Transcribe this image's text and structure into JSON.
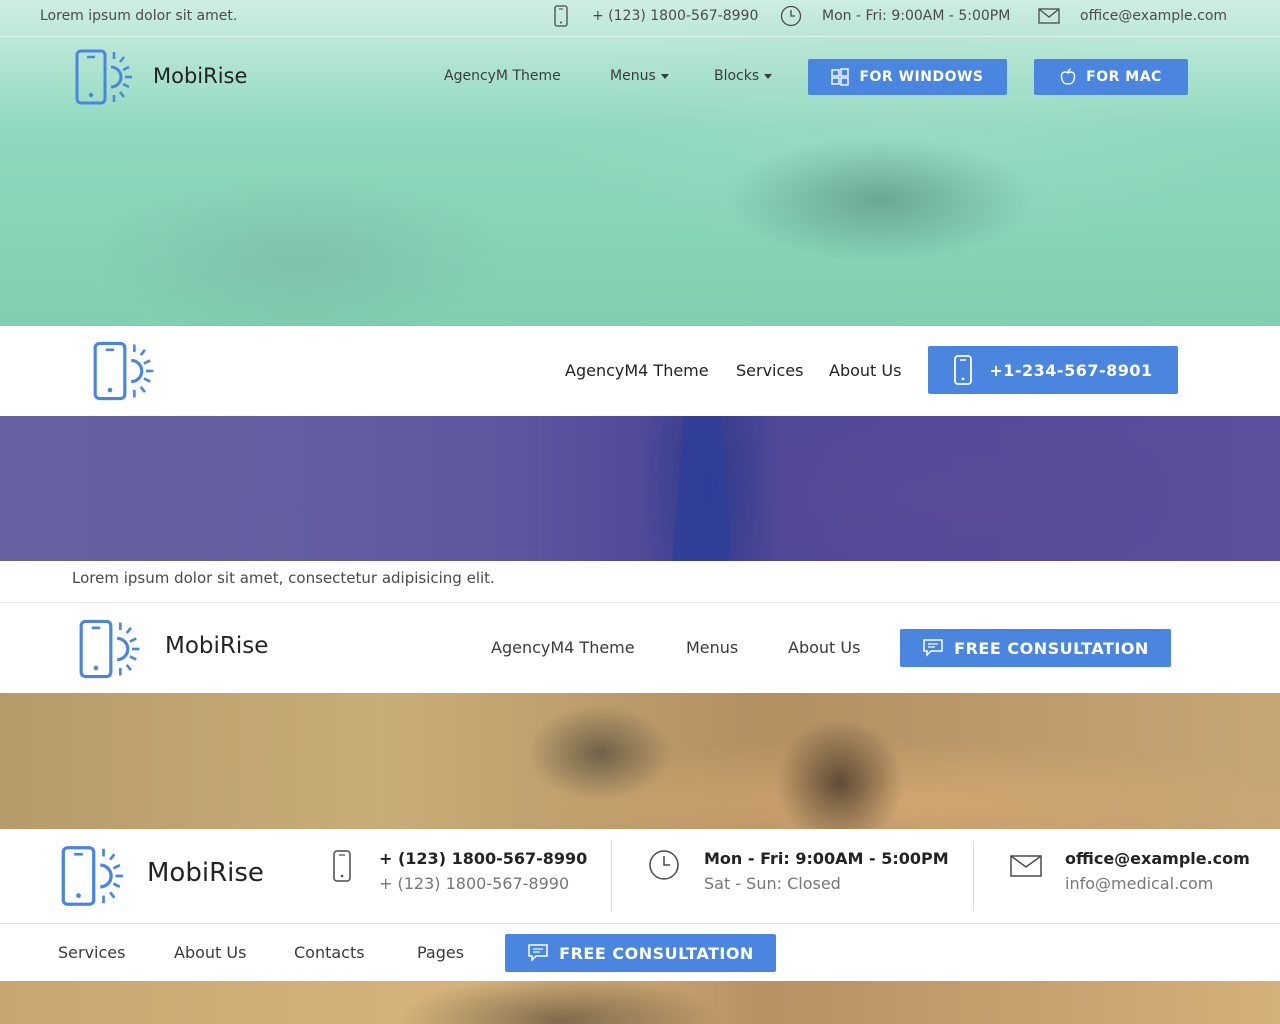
{
  "header1": {
    "tagline": "Lorem ipsum dolor sit amet.",
    "phone": "+ (123) 1800-567-8990",
    "hours": "Mon - Fri: 9:00AM - 5:00PM",
    "email": "office@example.com",
    "brand": "MobiRise",
    "nav": {
      "item1": "AgencyM Theme",
      "item2": "Menus",
      "item3": "Blocks"
    },
    "btn_windows": "FOR WINDOWS",
    "btn_mac": "FOR MAC"
  },
  "header2": {
    "nav": {
      "item1": "AgencyM4 Theme",
      "item2": "Services",
      "item3": "About Us"
    },
    "phone_button": "+1-234-567-8901"
  },
  "header3": {
    "announcement": "Lorem ipsum dolor sit amet, consectetur adipisicing elit.",
    "brand": "MobiRise",
    "nav": {
      "item1": "AgencyM4 Theme",
      "item2": "Menus",
      "item3": "About Us"
    },
    "cta": "FREE CONSULTATION"
  },
  "header4": {
    "brand": "MobiRise",
    "phone_primary": "+ (123) 1800-567-8990",
    "phone_secondary": "+ (123) 1800-567-8990",
    "hours_primary": "Mon - Fri: 9:00AM - 5:00PM",
    "hours_secondary": "Sat - Sun: Closed",
    "email_primary": "office@example.com",
    "email_secondary": "info@medical.com",
    "nav": {
      "item1": "Services",
      "item2": "About Us",
      "item3": "Contacts",
      "item4": "Pages"
    },
    "cta": "FREE CONSULTATION"
  },
  "colors": {
    "accent": "#4a86e0",
    "text": "#232323",
    "muted": "#767676"
  },
  "icons": [
    "mobile-sun-logo-icon",
    "phone-icon",
    "clock-icon",
    "envelope-icon",
    "windows-icon",
    "apple-icon",
    "chat-bubble-icon"
  ]
}
